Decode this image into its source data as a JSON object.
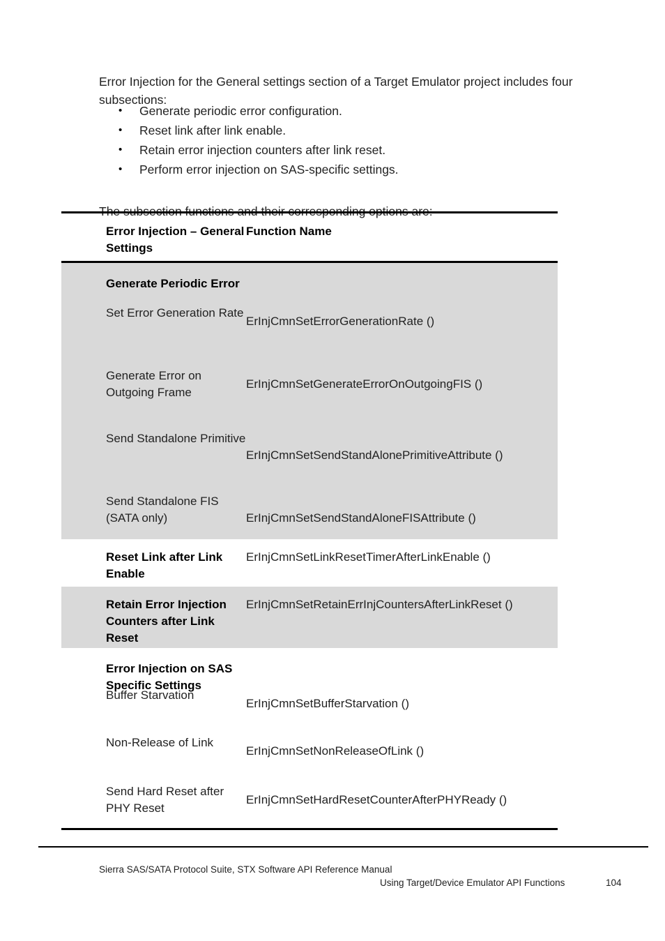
{
  "body": {
    "intro_paragraph": "Error Injection for the General settings section of a Target Emulator project includes four subsections:",
    "bullets": [
      "Generate periodic error configuration.",
      "Reset link after link enable.",
      "Retain error injection counters after link reset.",
      "Perform error injection on SAS-specific settings."
    ],
    "bullet_marker": "•",
    "leadin_paragraph": "The subsection functions and their corresponding options are:"
  },
  "table": {
    "headers": {
      "col1": "Error Injection – General Settings",
      "col2": "Function Name"
    },
    "shading_color": "#d9d9d9",
    "rows": [
      {
        "label": "Generate Periodic Error",
        "function": "",
        "bold": true,
        "shaded": true
      },
      {
        "label": "Set Error Generation Rate",
        "function": "ErInjCmnSetErrorGenerationRate ()",
        "bold": false,
        "shaded": true
      },
      {
        "label": "Generate Error on Outgoing Frame",
        "function": "ErInjCmnSetGenerateErrorOnOutgoingFIS ()",
        "bold": false,
        "shaded": true
      },
      {
        "label": "Send Standalone Primitive",
        "function": "ErInjCmnSetSendStandAlonePrimitiveAttribute ()",
        "bold": false,
        "shaded": true
      },
      {
        "label": "Send Standalone FIS (SATA only)",
        "function": "ErInjCmnSetSendStandAloneFISAttribute ()",
        "bold": false,
        "shaded": true
      },
      {
        "label": "Reset Link after Link Enable",
        "function": "ErInjCmnSetLinkResetTimerAfterLinkEnable ()",
        "bold": true,
        "shaded": false
      },
      {
        "label": "Retain Error Injection Counters after Link Reset",
        "function": "ErInjCmnSetRetainErrInjCountersAfterLinkReset ()",
        "bold": true,
        "shaded": true
      },
      {
        "label": "Error Injection on SAS Specific Settings",
        "function": "",
        "bold": true,
        "shaded": false
      },
      {
        "label": "Buffer Starvation",
        "function": "ErInjCmnSetBufferStarvation ()",
        "bold": false,
        "shaded": false
      },
      {
        "label": "Non-Release of Link",
        "function": "ErInjCmnSetNonReleaseOfLink ()",
        "bold": false,
        "shaded": false
      },
      {
        "label": "Send Hard Reset after PHY Reset",
        "function": "ErInjCmnSetHardResetCounterAfterPHYReady ()",
        "bold": false,
        "shaded": false
      }
    ]
  },
  "footer": {
    "manual_title": "Sierra SAS/SATA Protocol Suite, STX Software API Reference Manual",
    "section_title": "Using Target/Device Emulator API Functions",
    "page_number": "104"
  }
}
